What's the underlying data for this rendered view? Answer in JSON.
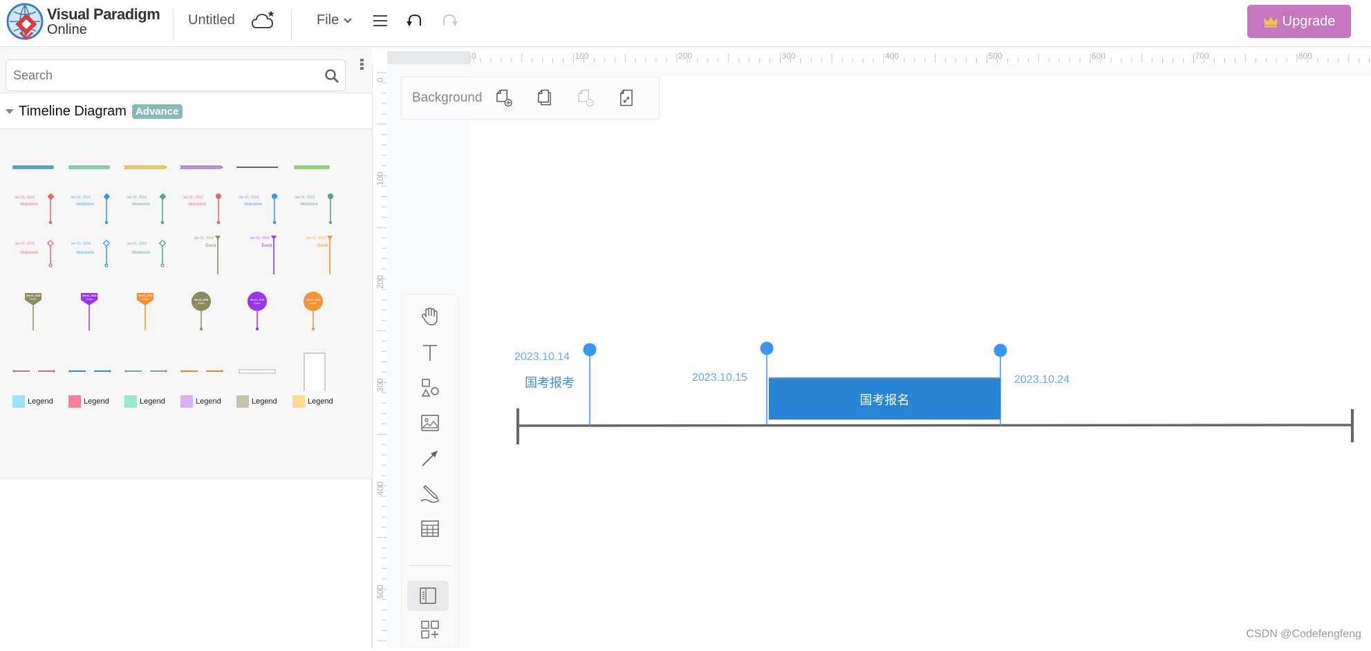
{
  "app": {
    "logo_line1": "Visual Paradigm",
    "logo_line2": "Online",
    "doc_title": "Untitled",
    "file_menu": "File",
    "upgrade_label": "Upgrade",
    "colors": {
      "upgrade_bg": "#c577bd",
      "accent_blue": "#2a84d6",
      "marker_blue": "#3797f5"
    }
  },
  "toolbar": {
    "icons": [
      "cloud-save-icon",
      "chevron-down-icon",
      "hamburger-menu-icon",
      "undo-icon",
      "redo-icon"
    ],
    "redo_enabled": false
  },
  "sidebar": {
    "search_placeholder": "Search",
    "search_value": "",
    "category": {
      "title": "Timeline Diagram",
      "badge": "Advance",
      "expanded": true
    },
    "shape_rows": [
      {
        "kind": "bars",
        "items": [
          "timeline-bar-blue",
          "timeline-bar-green",
          "timeline-bar-yellow",
          "timeline-bar-purple",
          "timeline-line-dark",
          "timeline-bar-lime"
        ]
      },
      {
        "kind": "milestone",
        "date": "Jan 01, 2018",
        "label": "Milestone",
        "colors": [
          "#e86464",
          "#3797f5",
          "#5aa08e",
          "#e86464",
          "#3797f5",
          "#5aa08e"
        ],
        "markers": [
          "diamond",
          "diamond",
          "diamond",
          "circle",
          "circle",
          "circle"
        ]
      },
      {
        "kind": "milestone-outline",
        "date": "Jan 01, 2018",
        "labels": [
          "Milestone",
          "Milestone",
          "Milestone",
          "Event",
          "Event",
          "Event"
        ],
        "colors": [
          "#e86464",
          "#3797f5",
          "#5aa08e",
          "#8d8a60",
          "#9a33f0",
          "#f5922f"
        ]
      },
      {
        "kind": "event-flag",
        "date": "Jan 01, 2018",
        "label": "Event",
        "colors": [
          "#8d8a60",
          "#9a33f0",
          "#f5922f",
          "#8d8a60",
          "#9a33f0",
          "#f5922f"
        ]
      },
      {
        "kind": "period-line",
        "colors": [
          "#b4769e",
          "#2f8ae8",
          "#74a898",
          "#f0862a",
          "#bbbbbb",
          "#bbbbbb"
        ]
      }
    ],
    "legends": [
      {
        "label": "Legend",
        "color": "#9de2f7"
      },
      {
        "label": "Legend",
        "color": "#ff7f9c"
      },
      {
        "label": "Legend",
        "color": "#96e8d0"
      },
      {
        "label": "Legend",
        "color": "#d7b0f7"
      },
      {
        "label": "Legend",
        "color": "#c4c2ac"
      },
      {
        "label": "Legend",
        "color": "#ffda8d"
      }
    ]
  },
  "canvas": {
    "background_label": "Background",
    "background_actions": [
      "add-page-icon",
      "duplicate-page-icon",
      "delete-page-icon",
      "resize-page-icon"
    ],
    "ruler_h": [
      "0",
      "100",
      "200",
      "300",
      "400",
      "500",
      "600",
      "700",
      "800"
    ],
    "ruler_v": [
      "0",
      "100",
      "200",
      "300",
      "400",
      "500"
    ],
    "tools": [
      "hand-tool",
      "text-tool",
      "shapes-tool",
      "image-tool",
      "connector-tool",
      "pen-tool",
      "table-tool",
      "panel-toggle",
      "add-shapes"
    ]
  },
  "diagram": {
    "events": [
      {
        "date": "2023.10.14",
        "label": "国考报考"
      },
      {
        "date": "2023.10.15",
        "label": ""
      },
      {
        "date": "2023.10.24",
        "label": ""
      }
    ],
    "period": {
      "label": "国考报名",
      "start": "2023.10.15",
      "end": "2023.10.24"
    }
  },
  "watermark": "CSDN @Codefengfeng"
}
